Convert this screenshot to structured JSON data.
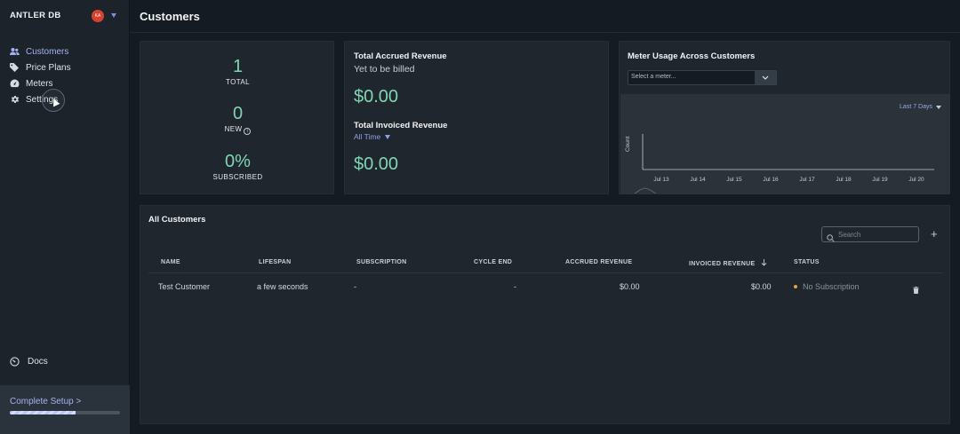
{
  "sidebar": {
    "brand": "ANTLER DB",
    "avatar_initials": "KA",
    "items": [
      {
        "label": "Customers",
        "icon": "users-icon",
        "active": true
      },
      {
        "label": "Price Plans",
        "icon": "tag-icon",
        "active": false
      },
      {
        "label": "Meters",
        "icon": "gauge-icon",
        "active": false
      },
      {
        "label": "Settings",
        "icon": "gear-icon",
        "active": false
      }
    ],
    "docs_label": "Docs",
    "setup": {
      "label": "Complete Setup >",
      "progress": 0.6
    }
  },
  "header": {
    "title": "Customers"
  },
  "stats": {
    "total": {
      "value": "1",
      "label": "TOTAL"
    },
    "new": {
      "value": "0",
      "label": "NEW"
    },
    "subscribed": {
      "value": "0%",
      "label": "SUBSCRIBED"
    }
  },
  "revenue": {
    "accrued_title": "Total Accrued Revenue",
    "accrued_sub": "Yet to be billed",
    "accrued_amount": "$0.00",
    "invoiced_title": "Total Invoiced Revenue",
    "invoiced_filter": "All Time",
    "invoiced_amount": "$0.00"
  },
  "meter": {
    "title": "Meter Usage Across Customers",
    "select_placeholder": "Select a meter...",
    "range": "Last 7 Days",
    "y_label": "Count",
    "x_ticks": [
      "Jul 13",
      "Jul 14",
      "Jul 15",
      "Jul 16",
      "Jul 17",
      "Jul 18",
      "Jul 19",
      "Jul 20"
    ]
  },
  "customers_table": {
    "title": "All Customers",
    "search_placeholder": "Search",
    "add_label": "+",
    "columns": [
      "NAME",
      "LIFESPAN",
      "SUBSCRIPTION",
      "CYCLE END",
      "ACCRUED REVENUE",
      "INVOICED REVENUE",
      "STATUS"
    ],
    "rows": [
      {
        "name": "Test Customer",
        "lifespan": "a few seconds",
        "subscription": "-",
        "cycle_end": "-",
        "accrued": "$0.00",
        "invoiced": "$0.00",
        "status": "No Subscription"
      }
    ]
  },
  "colors": {
    "accent": "#a4b3f0",
    "value_green": "#7fd6b5",
    "status_orange": "#e9a23b",
    "avatar_red": "#d9412f"
  }
}
